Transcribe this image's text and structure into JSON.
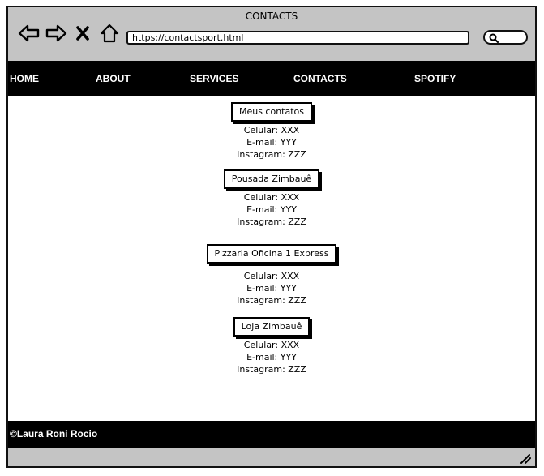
{
  "window": {
    "title": "CONTACTS"
  },
  "browser": {
    "url": "https://contactsport.html",
    "icons": [
      "back-arrow-icon",
      "forward-arrow-icon",
      "close-x-icon",
      "home-icon",
      "search-icon",
      "resize-grip-icon"
    ]
  },
  "nav": {
    "items": [
      {
        "label": "HOME"
      },
      {
        "label": "ABOUT"
      },
      {
        "label": "SERVICES"
      },
      {
        "label": "CONTACTS"
      },
      {
        "label": "SPOTIFY"
      }
    ]
  },
  "contacts": [
    {
      "title": "Meus contatos",
      "lines": [
        "Celular: XXX",
        "E-mail: YYY",
        "Instagram: ZZZ"
      ]
    },
    {
      "title": "Pousada Zimbauê",
      "lines": [
        "Celular: XXX",
        "E-mail: YYY",
        "Instagram: ZZZ"
      ]
    },
    {
      "title": "Pizzaria Oficina 1 Express",
      "lines": [
        "Celular: XXX",
        "E-mail: YYY",
        "Instagram: ZZZ"
      ]
    },
    {
      "title": "Loja Zimbauê",
      "lines": [
        "Celular: XXX",
        "E-mail: YYY",
        "Instagram: ZZZ"
      ]
    }
  ],
  "footer": {
    "text": "©Laura Roni Rocio"
  },
  "colors": {
    "chrome": "#c4c4c4",
    "navbar": "#000000",
    "page": "#ffffff",
    "text_on_dark": "#ffffff"
  }
}
